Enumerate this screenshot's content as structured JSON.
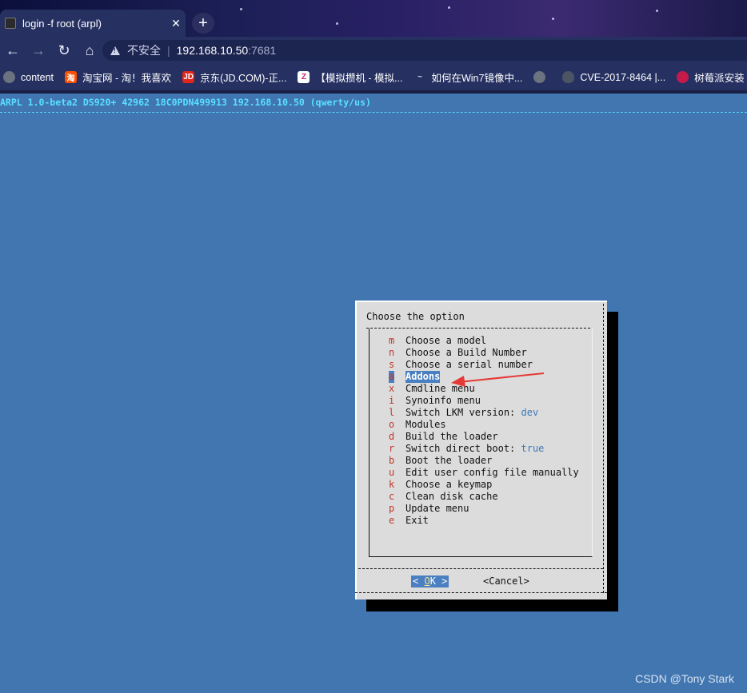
{
  "browser": {
    "tab_title": "login -f root (arpl)",
    "tab_close": "✕",
    "new_tab": "+",
    "nav": {
      "back": "←",
      "forward": "→",
      "reload": "↻",
      "home": "⌂"
    },
    "security_label": "不安全",
    "url_host": "192.168.10.50",
    "url_port": ":7681",
    "bookmarks": [
      {
        "label": "content",
        "icon": "globe-icon",
        "color": "#6b7280"
      },
      {
        "label": "淘宝网 - 淘！我喜欢",
        "icon": "taobao-icon",
        "color": "#ff5000"
      },
      {
        "label": "京东(JD.COM)-正...",
        "icon": "jd-icon",
        "color": "#e1251b"
      },
      {
        "label": "【模拟攒机 - 模拟...",
        "icon": "zol-icon",
        "color": "#ffffff"
      },
      {
        "label": "如何在Win7镜像中...",
        "icon": "site-icon",
        "color": "#9ca3af"
      },
      {
        "label": "",
        "icon": "globe-icon",
        "color": "#6b7280"
      },
      {
        "label": "CVE-2017-8464 |...",
        "icon": "shield-icon",
        "color": "#6b7280"
      },
      {
        "label": "树莓派安装",
        "icon": "raspberry-icon",
        "color": "#c51a4a"
      }
    ]
  },
  "terminal": {
    "header": "ARPL 1.0-beta2 DS920+ 42962 18C0PDN499913 192.168.10.50 (qwerty/us)",
    "dialog": {
      "title": "Choose the option",
      "items": [
        {
          "key": "m",
          "label": "Choose a model",
          "value": ""
        },
        {
          "key": "n",
          "label": "Choose a Build Number",
          "value": ""
        },
        {
          "key": "s",
          "label": "Choose a serial number",
          "value": ""
        },
        {
          "key": "a",
          "label": "Addons",
          "value": "",
          "selected": true
        },
        {
          "key": "x",
          "label": "Cmdline menu",
          "value": ""
        },
        {
          "key": "i",
          "label": "Synoinfo menu",
          "value": ""
        },
        {
          "key": "l",
          "label": "Switch LKM version: ",
          "value": "dev"
        },
        {
          "key": "o",
          "label": "Modules",
          "value": ""
        },
        {
          "key": "d",
          "label": "Build the loader",
          "value": ""
        },
        {
          "key": "r",
          "label": "Switch direct boot: ",
          "value": "true"
        },
        {
          "key": "b",
          "label": "Boot the loader",
          "value": ""
        },
        {
          "key": "u",
          "label": "Edit user config file manually",
          "value": ""
        },
        {
          "key": "k",
          "label": "Choose a keymap",
          "value": ""
        },
        {
          "key": "c",
          "label": "Clean disk cache",
          "value": ""
        },
        {
          "key": "p",
          "label": "Update menu",
          "value": ""
        },
        {
          "key": "e",
          "label": "Exit",
          "value": ""
        }
      ],
      "ok_left": "< ",
      "ok_hot": "O",
      "ok_rest": "K",
      "ok_right": " >",
      "cancel": "<Cancel>"
    }
  },
  "annotation": {
    "arrow_color": "#e53935"
  },
  "watermark": "CSDN @Tony Stark"
}
